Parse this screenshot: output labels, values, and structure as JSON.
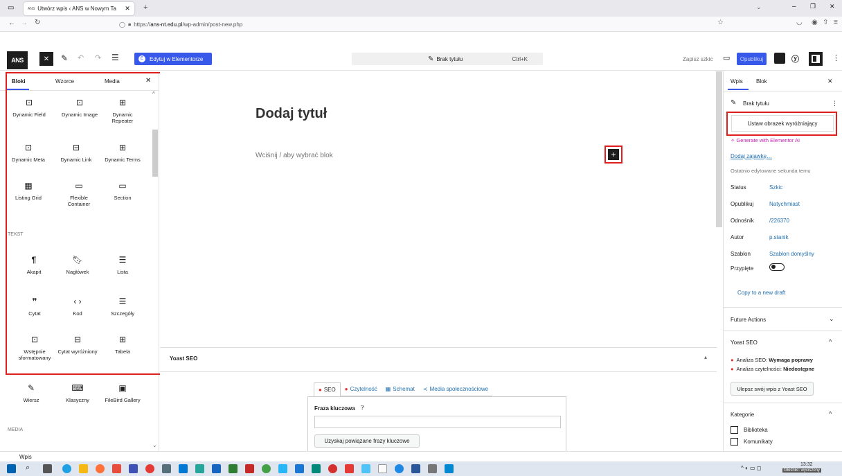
{
  "browser": {
    "tab_title": "Utwórz wpis ‹ ANS w Nowym Ta",
    "url_prefix": "https://",
    "url_domain": "ans-nt.edu.pl",
    "url_path": "/wp-admin/post-new.php"
  },
  "toolbar": {
    "logo": "ANS",
    "elementor_label": "Edytuj w Elementorze",
    "doc_title": "Brak tytułu",
    "shortcut": "Ctrl+K",
    "save_draft": "Zapisz szkic",
    "publish": "Opublikuj"
  },
  "inserter": {
    "tabs": [
      "Bloki",
      "Wzorce",
      "Media"
    ],
    "row1": [
      "Dynamic Field",
      "Dynamic Image",
      "Dynamic Repeater"
    ],
    "row2": [
      "Dynamic Meta",
      "Dynamic Link",
      "Dynamic Terms"
    ],
    "row3": [
      "Listing Grid",
      "Flexible Container",
      "Section"
    ],
    "section_text": "TEKST",
    "row4": [
      "Akapit",
      "Nagłówek",
      "Lista"
    ],
    "row5": [
      "Cytat",
      "Kod",
      "Szczegóły"
    ],
    "row6": [
      "Wstępnie sformatowany",
      "Cytat wyróżniony",
      "Tabela"
    ],
    "row7": [
      "Wiersz",
      "Klasyczny",
      "FileBird Gallery"
    ],
    "section_media": "MEDIA"
  },
  "editor": {
    "title_placeholder": "Dodaj tytuł",
    "block_placeholder": "Wciśnij / aby wybrać blok"
  },
  "yoast": {
    "header": "Yoast SEO",
    "tabs": [
      "SEO",
      "Czytelność",
      "Schemat",
      "Media społecznościowe"
    ],
    "keyphrase_label": "Fraza kluczowa",
    "related_button": "Uzyskaj powiązane frazy kluczowe"
  },
  "sidebar": {
    "tabs": [
      "Wpis",
      "Blok"
    ],
    "post_title": "Brak tytułu",
    "featured_button": "Ustaw obrazek wyróżniający",
    "generate_ai": "Generate with Elementor AI",
    "add_excerpt": "Dodaj zajawkę…",
    "last_edited": "Ostatnio edytowane sekunda temu",
    "fields": [
      {
        "label": "Status",
        "value": "Szkic"
      },
      {
        "label": "Opublikuj",
        "value": "Natychmiast"
      },
      {
        "label": "Odnośnik",
        "value": "/226370"
      },
      {
        "label": "Autor",
        "value": "p.stanik"
      },
      {
        "label": "Szablon",
        "value": "Szablon domyślny"
      },
      {
        "label": "Przypięte",
        "value": ""
      }
    ],
    "copy_draft": "Copy to a new draft",
    "future_actions": "Future Actions",
    "yoast_title": "Yoast SEO",
    "seo_analysis_label": "Analiza SEO:",
    "seo_analysis_value": "Wymaga poprawy",
    "readability_label": "Analiza czytelności:",
    "readability_value": "Niedostępne",
    "improve_button": "Ulepsz swój wpis z Yoast SEO",
    "categories_title": "Kategorie",
    "categories": [
      "Biblioteka",
      "Komunikaty"
    ]
  },
  "status_bar": {
    "breadcrumb": "Wpis"
  },
  "taskbar": {
    "time": "13:32",
    "tooltip": "Głośniki: wyciszony"
  },
  "colors": {
    "accent": "#3858e9",
    "blue_button": "#2271b1",
    "highlight": "#e01e1e",
    "taskbar": "#dfe6ef"
  }
}
